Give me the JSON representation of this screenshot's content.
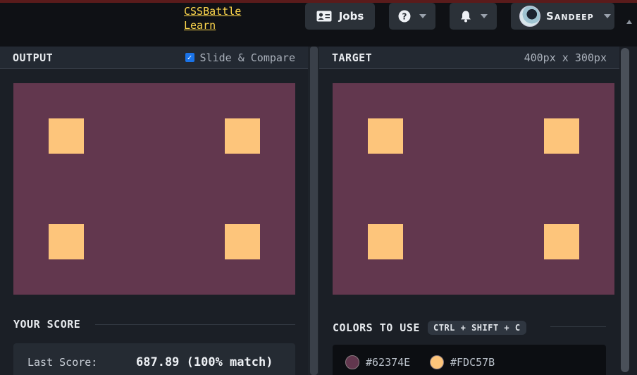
{
  "nav": {
    "links": [
      "CSSBattle",
      "Learn"
    ],
    "jobs_label": "Jobs",
    "user_name": "Sandeep"
  },
  "output": {
    "title": "OUTPUT",
    "slide_compare_label": "Slide & Compare",
    "slide_compare_checked": true
  },
  "target": {
    "title": "TARGET",
    "dimensions": "400px x 300px"
  },
  "canvas": {
    "background": "#62374E",
    "square_color": "#FDC57B"
  },
  "score": {
    "title": "YOUR SCORE",
    "last_score_label": "Last Score:",
    "last_score_value": "687.89 (100% match)"
  },
  "colors": {
    "title": "COLORS TO USE",
    "shortcut": "CTRL + SHIFT + C",
    "list": [
      "#62374E",
      "#FDC57B"
    ]
  },
  "icons": {
    "jobs": "id-card-icon",
    "help": "question-circle-icon",
    "notifications": "bell-icon"
  }
}
